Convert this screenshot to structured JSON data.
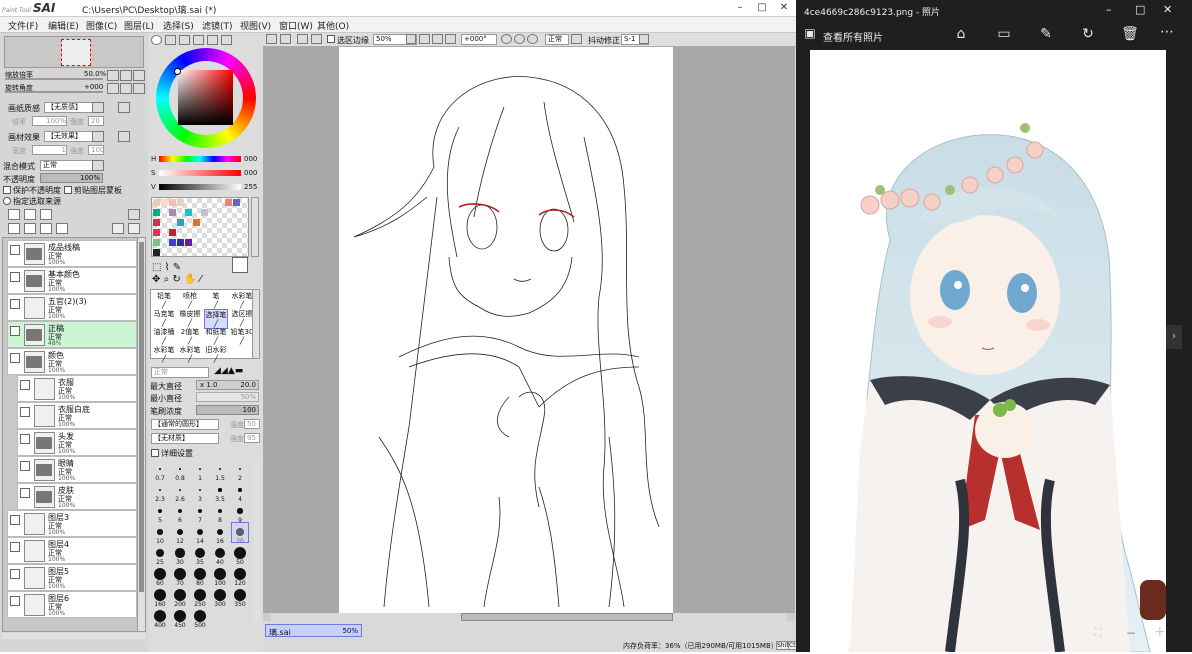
{
  "sai": {
    "logo_small": "Paint Tool",
    "logo": "SAI",
    "path": "C:\\Users\\PC\\Desktop\\璃.sai (*)",
    "menu": [
      "文件(F)",
      "编辑(E)",
      "图像(C)",
      "图层(L)",
      "选择(S)",
      "滤镜(T)",
      "视图(V)",
      "窗口(W)",
      "其他(O)"
    ],
    "nav": {
      "zoom_label": "缩放倍率",
      "zoom_value": "50.0%",
      "rotate_label": "旋转角度",
      "rotate_value": "+000"
    },
    "paper": {
      "texture_label": "画纸质感",
      "texture_value": "【无质感】",
      "scale_label": "倍率",
      "scale_value": "100%",
      "strength_label": "强度",
      "strength_value": "20",
      "effect_label": "画材效果",
      "effect_value": "【无效果】",
      "width_label": "宽度",
      "width_value": "1",
      "strength2_value": "100"
    },
    "blend": {
      "label": "混合模式",
      "value": "正常",
      "opacity_label": "不透明度",
      "opacity_value": "100%"
    },
    "checks": {
      "protect": "保护不透明度",
      "clip": "剪贴图层蒙板",
      "select_src": "指定选取来源"
    },
    "layers": [
      {
        "name": "成品线稿",
        "mode": "正常",
        "opacity": "100%",
        "type": "folder"
      },
      {
        "name": "基本颜色",
        "mode": "正常",
        "opacity": "100%",
        "type": "folder"
      },
      {
        "name": "五官(2)(3)",
        "mode": "正常",
        "opacity": "100%",
        "type": "layer"
      },
      {
        "name": "正稿",
        "mode": "正常",
        "opacity": "48%",
        "type": "folder",
        "selected": true
      },
      {
        "name": "颜色",
        "mode": "正常",
        "opacity": "100%",
        "type": "folder"
      },
      {
        "name": "衣服",
        "mode": "正常",
        "opacity": "100%",
        "type": "layer",
        "indent": true
      },
      {
        "name": "衣服白底",
        "mode": "正常",
        "opacity": "100%",
        "type": "layer",
        "indent": true
      },
      {
        "name": "头发",
        "mode": "正常",
        "opacity": "100%",
        "type": "folder",
        "indent": true
      },
      {
        "name": "眼睛",
        "mode": "正常",
        "opacity": "100%",
        "type": "folder",
        "indent": true
      },
      {
        "name": "皮肤",
        "mode": "正常",
        "opacity": "100%",
        "type": "folder",
        "indent": true
      },
      {
        "name": "图层3",
        "mode": "正常",
        "opacity": "100%",
        "type": "layer"
      },
      {
        "name": "图层4",
        "mode": "正常",
        "opacity": "100%",
        "type": "layer"
      },
      {
        "name": "图层5",
        "mode": "正常",
        "opacity": "100%",
        "type": "layer"
      },
      {
        "name": "图层6",
        "mode": "正常",
        "opacity": "100%",
        "type": "layer"
      }
    ],
    "hsv": {
      "h_label": "H",
      "h_value": "000",
      "s_label": "S",
      "s_value": "000",
      "v_label": "V",
      "v_value": "255"
    },
    "tools": [
      "铅笔",
      "喷枪",
      "笔",
      "水彩笔",
      "马克笔",
      "橡皮擦",
      "选择笔",
      "选区擦",
      "油漆桶",
      "2值笔",
      "和纸笔",
      "铅笔30",
      "水彩笔",
      "水彩笔",
      "旧水彩"
    ],
    "brush": {
      "mode": "正常",
      "max_label": "最大直径",
      "max_mult": "x 1.0",
      "max_value": "20.0",
      "min_label": "最小直径",
      "min_value": "50%",
      "density_label": "笔刷浓度",
      "density_value": "100",
      "shape": "【通常的圆形】",
      "shape_strength_label": "强度",
      "shape_strength": "50",
      "texture": "【无材质】",
      "texture_strength_label": "强度",
      "texture_strength": "95",
      "detail": "详细设置"
    },
    "sizes": [
      "0.7",
      "0.8",
      "1",
      "1.5",
      "2",
      "2.3",
      "2.6",
      "3",
      "3.5",
      "4",
      "5",
      "6",
      "7",
      "8",
      "9",
      "10",
      "12",
      "14",
      "16",
      "20",
      "25",
      "30",
      "35",
      "40",
      "50",
      "60",
      "70",
      "80",
      "100",
      "120",
      "160",
      "200",
      "250",
      "300",
      "350",
      "400",
      "450",
      "500"
    ],
    "canvas_toolbar": {
      "select_edge": "选区边缘",
      "zoom": "50%",
      "angle": "+000°",
      "mode": "正常",
      "stabilizer_label": "抖动修正",
      "stabilizer_value": "S-1"
    },
    "tab": {
      "name": "璃.sai",
      "zoom": "50%"
    },
    "status": "内存负荷率：36%（已用290MB/可用1015MB）",
    "status_key": [
      "Shift",
      "Ctrl"
    ]
  },
  "photos": {
    "title": "4ce4669c286c9123.png - 照片",
    "view_all": "查看所有照片",
    "accent": "#1f1f1f"
  }
}
